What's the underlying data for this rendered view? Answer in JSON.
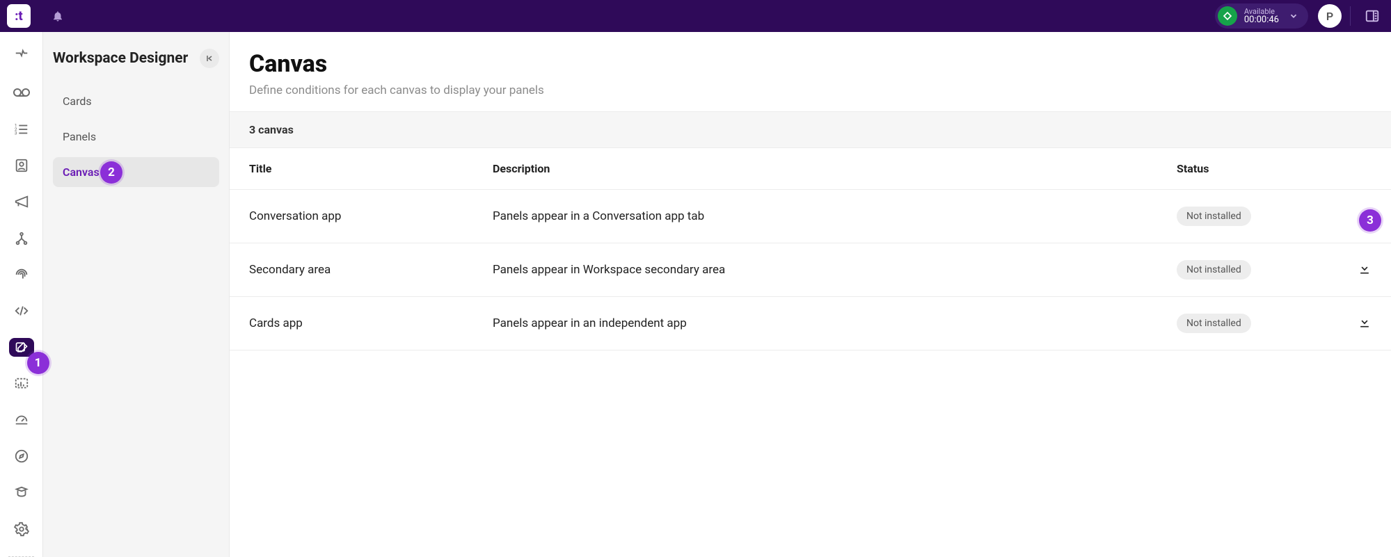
{
  "topbar": {
    "logo_letter": "t",
    "status_label": "Available",
    "status_time": "00:00:46",
    "avatar_letter": "P"
  },
  "sidepanel": {
    "title": "Workspace Designer",
    "items": [
      {
        "label": "Cards",
        "active": false
      },
      {
        "label": "Panels",
        "active": false
      },
      {
        "label": "Canvas",
        "active": true
      }
    ]
  },
  "page": {
    "title": "Canvas",
    "subtitle": "Define conditions for each canvas to display your panels",
    "count_text": "3 canvas",
    "columns": {
      "title": "Title",
      "description": "Description",
      "status": "Status"
    },
    "rows": [
      {
        "title": "Conversation app",
        "description": "Panels appear in a Conversation app tab",
        "status": "Not installed"
      },
      {
        "title": "Secondary area",
        "description": "Panels appear in Workspace secondary area",
        "status": "Not installed"
      },
      {
        "title": "Cards app",
        "description": "Panels appear in an independent app",
        "status": "Not installed"
      }
    ]
  },
  "annotations": {
    "one": "1",
    "two": "2",
    "three": "3"
  }
}
